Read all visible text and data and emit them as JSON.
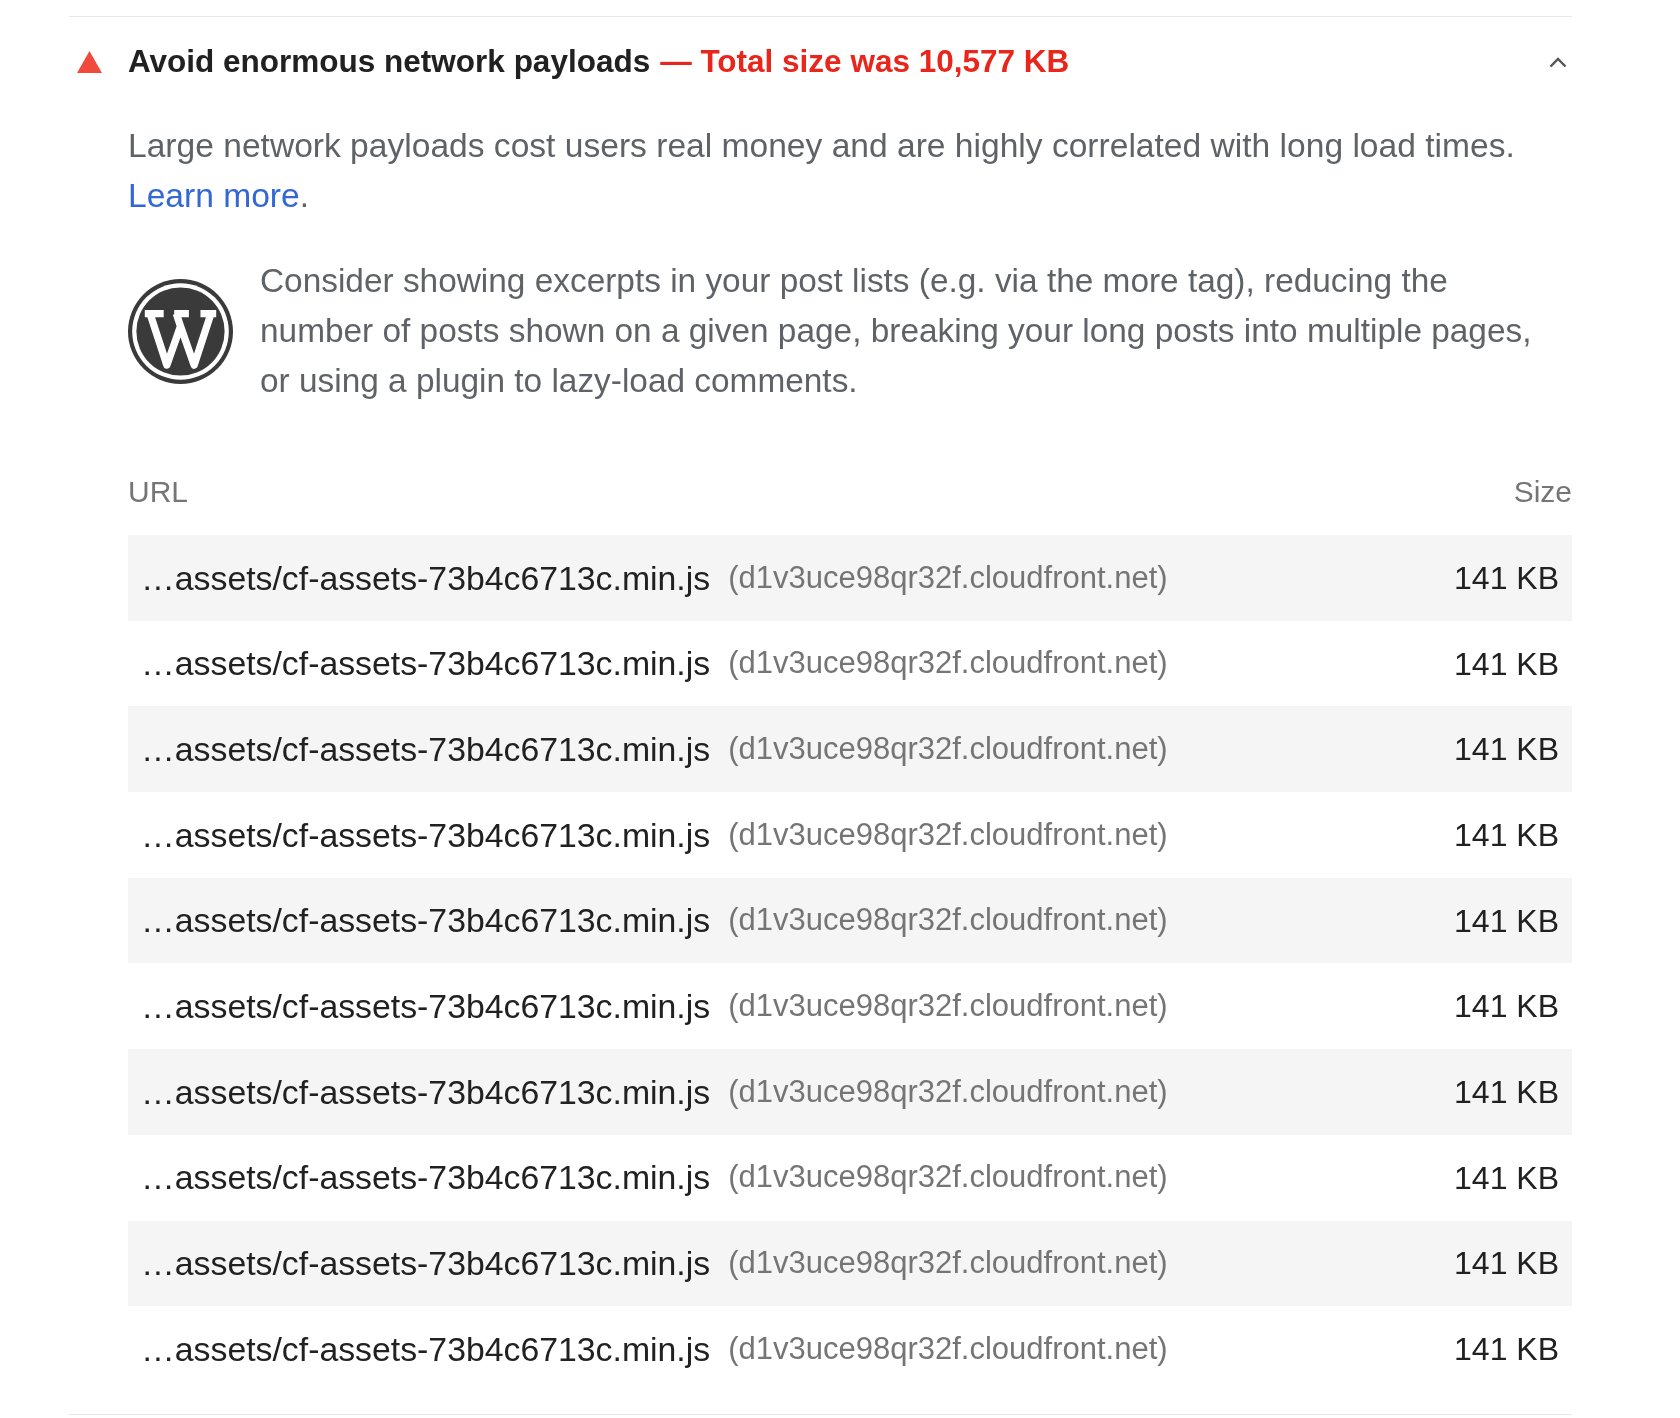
{
  "audit": {
    "passed": false,
    "title": "Avoid enormous network payloads",
    "display_value": "— Total size was 10,577 KB",
    "expanded": true,
    "description": "Large network payloads cost users real money and are highly correlated with long load times.",
    "learn_more": "Learn more",
    "learn_more_suffix": "."
  },
  "stack_pack": {
    "description": "Consider showing excerpts in your post lists (e.g. via the more tag), reducing the number of posts shown on a given page, breaking your long posts into multiple pages, or using a plugin to lazy-load comments."
  },
  "table": {
    "columns": [
      "URL",
      "Size"
    ],
    "rows": [
      {
        "url": "…assets/cf-assets-73b4c6713c.min.js",
        "host": "(d1v3uce98qr32f.cloudfront.net)",
        "size": "141 KB"
      },
      {
        "url": "…assets/cf-assets-73b4c6713c.min.js",
        "host": "(d1v3uce98qr32f.cloudfront.net)",
        "size": "141 KB"
      },
      {
        "url": "…assets/cf-assets-73b4c6713c.min.js",
        "host": "(d1v3uce98qr32f.cloudfront.net)",
        "size": "141 KB"
      },
      {
        "url": "…assets/cf-assets-73b4c6713c.min.js",
        "host": "(d1v3uce98qr32f.cloudfront.net)",
        "size": "141 KB"
      },
      {
        "url": "…assets/cf-assets-73b4c6713c.min.js",
        "host": "(d1v3uce98qr32f.cloudfront.net)",
        "size": "141 KB"
      },
      {
        "url": "…assets/cf-assets-73b4c6713c.min.js",
        "host": "(d1v3uce98qr32f.cloudfront.net)",
        "size": "141 KB"
      },
      {
        "url": "…assets/cf-assets-73b4c6713c.min.js",
        "host": "(d1v3uce98qr32f.cloudfront.net)",
        "size": "141 KB"
      },
      {
        "url": "…assets/cf-assets-73b4c6713c.min.js",
        "host": "(d1v3uce98qr32f.cloudfront.net)",
        "size": "141 KB"
      },
      {
        "url": "…assets/cf-assets-73b4c6713c.min.js",
        "host": "(d1v3uce98qr32f.cloudfront.net)",
        "size": "141 KB"
      },
      {
        "url": "…assets/cf-assets-73b4c6713c.min.js",
        "host": "(d1v3uce98qr32f.cloudfront.net)",
        "size": "141 KB"
      }
    ]
  }
}
